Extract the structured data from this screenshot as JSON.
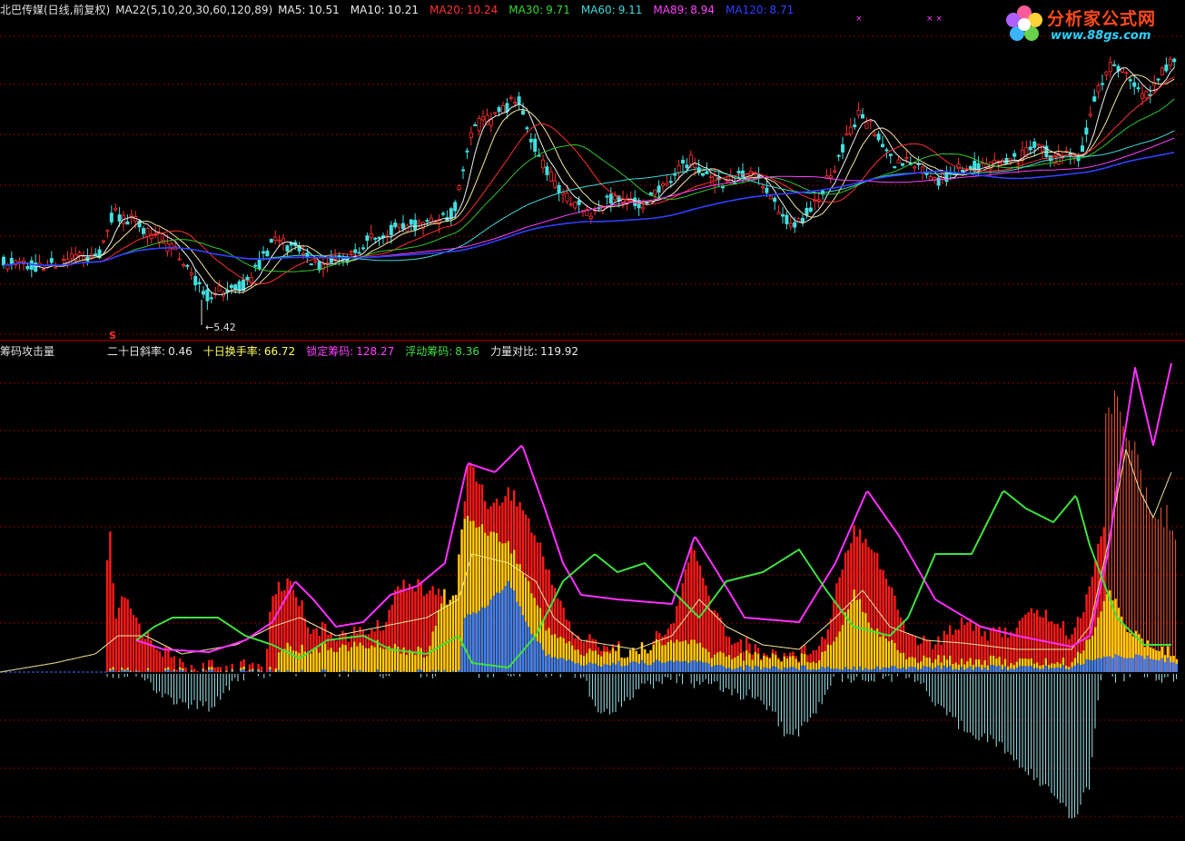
{
  "header": {
    "stock": "北巴传媒(日线,前复权)",
    "ma_group": "MA22(5,10,20,30,60,120,89)",
    "items": [
      {
        "label": "MA5:",
        "value": "10.51",
        "color": "#e8e8e8"
      },
      {
        "label": "MA10:",
        "value": "10.21",
        "color": "#e8e8e8"
      },
      {
        "label": "MA20:",
        "value": "10.24",
        "color": "#ff3030"
      },
      {
        "label": "MA30:",
        "value": "9.71",
        "color": "#30d830"
      },
      {
        "label": "MA60:",
        "value": "9.11",
        "color": "#40d8d8"
      },
      {
        "label": "MA89:",
        "value": "8.94",
        "color": "#ff40ff"
      },
      {
        "label": "MA120:",
        "value": "8.71",
        "color": "#3040ff"
      }
    ]
  },
  "price_panel": {
    "low_label": "5.42",
    "signal_mark": "S",
    "top_marks": [
      "×",
      "× ×"
    ]
  },
  "indicator": {
    "title": "筹码攻击量",
    "items": [
      {
        "label": "二十日斜率:",
        "value": "0.46",
        "color": "#e8e8e8"
      },
      {
        "label": "十日换手率:",
        "value": "66.72",
        "color": "#ffff60"
      },
      {
        "label": "锁定筹码:",
        "value": "128.27",
        "color": "#ff40ff"
      },
      {
        "label": "浮动筹码:",
        "value": "8.36",
        "color": "#40e040"
      },
      {
        "label": "力量对比:",
        "value": "119.92",
        "color": "#e8e8e8"
      }
    ]
  },
  "logo": {
    "name": "分析家公式网",
    "url": "www.88gs.com"
  },
  "colors": {
    "up": "#ff3030",
    "down": "#40e0e0",
    "grid": "#8a0000",
    "bar_red": "#ff1a1a",
    "bar_yellow": "#ffd000",
    "bar_blue": "#3a80ff",
    "neg": "#9fe8f0"
  }
}
